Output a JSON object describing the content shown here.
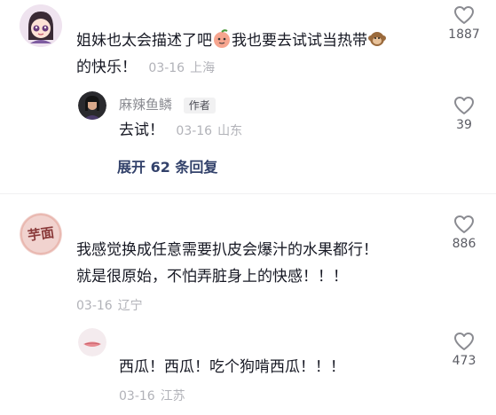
{
  "comments": [
    {
      "text_line1_a": "姐妹也太会描述了吧",
      "text_line1_b": "我也要去试试当热带",
      "text_line2": "的快乐！",
      "date": "03-16",
      "location": "上海",
      "likes": "1887",
      "inline_emojis": [
        "peach-face-icon",
        "monkey-icon"
      ],
      "reply": {
        "author": "麻辣鱼鳞",
        "author_tag": "作者",
        "text": "去试！",
        "date": "03-16",
        "location": "山东",
        "likes": "39"
      },
      "expand_label": "展开 62 条回复"
    },
    {
      "avatar_text": "芋面",
      "text_line1": "我感觉换成任意需要扒皮会爆汁的水果都行！",
      "text_line2": "就是很原始，不怕弄脏身上的快感！！！",
      "date": "03-16",
      "location": "辽宁",
      "likes": "886",
      "reply": {
        "text": "西瓜！西瓜！吃个狗啃西瓜！！！",
        "date": "03-16",
        "location": "江苏",
        "likes": "473"
      }
    }
  ],
  "colors": {
    "like_icon": "#8a8b91",
    "link": "#33426b",
    "meta": "#b1b2b8"
  }
}
